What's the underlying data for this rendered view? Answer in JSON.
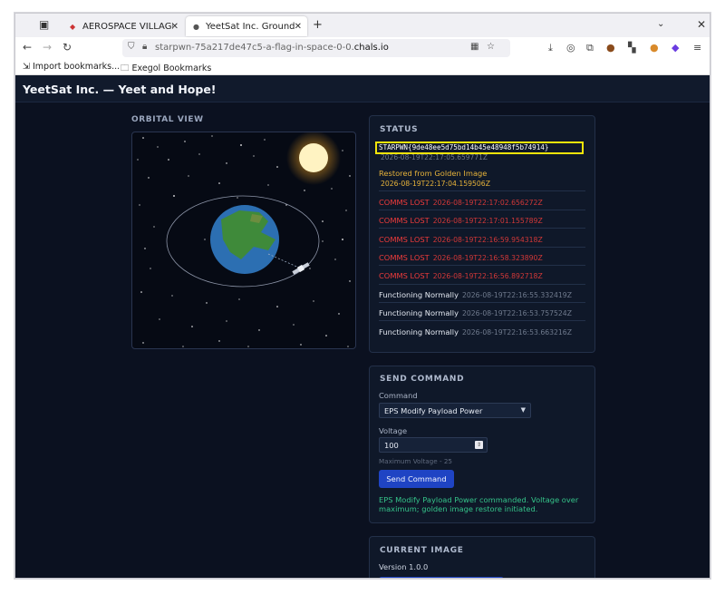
{
  "browser": {
    "tabs": [
      {
        "title": "AEROSPACE VILLAGE S",
        "active": false
      },
      {
        "title": "YeetSat Inc. Ground St",
        "active": true
      }
    ],
    "url_prefix": "starpwn-75a217de47c5-a-flag-in-space-0-0.",
    "url_domain": "chals.io",
    "bookmarks": [
      "Import bookmarks...",
      "Exegol Bookmarks"
    ]
  },
  "app": {
    "title": "YeetSat Inc. — Yeet and Hope!",
    "orbital_title": "ORBITAL VIEW"
  },
  "status": {
    "heading": "STATUS",
    "flag": "STARPWN{9de48ee5d75bd14b45e48948f5b74914}",
    "flag_ts": "2026-08-19T22:17:05.659771Z",
    "restored_label": "Restored from Golden Image",
    "restored_ts": "2026-08-19T22:17:04.159506Z",
    "lost": [
      {
        "label": "COMMS LOST",
        "ts": "2026-08-19T22:17:02.656272Z"
      },
      {
        "label": "COMMS LOST",
        "ts": "2026-08-19T22:17:01.155789Z"
      },
      {
        "label": "COMMS LOST",
        "ts": "2026-08-19T22:16:59.954318Z"
      },
      {
        "label": "COMMS LOST",
        "ts": "2026-08-19T22:16:58.323890Z"
      },
      {
        "label": "COMMS LOST",
        "ts": "2026-08-19T22:16:56.892718Z"
      }
    ],
    "normal": [
      {
        "label": "Functioning Normally",
        "ts": "2026-08-19T22:16:55.332419Z"
      },
      {
        "label": "Functioning Normally",
        "ts": "2026-08-19T22:16:53.757524Z"
      },
      {
        "label": "Functioning Normally",
        "ts": "2026-08-19T22:16:53.663216Z"
      }
    ]
  },
  "command": {
    "heading": "SEND COMMAND",
    "command_label": "Command",
    "command_value": "EPS Modify Payload Power",
    "voltage_label": "Voltage",
    "voltage_value": "100",
    "hint": "Maximum Voltage - 25",
    "send_label": "Send Command",
    "result": "EPS Modify Payload Power commanded. Voltage over maximum; golden image restore initiated."
  },
  "image": {
    "heading": "CURRENT IMAGE",
    "version": "Version 1.0.0"
  },
  "colors": {
    "flag_border": "#f3e40a",
    "lost": "#ef3b3b",
    "restored": "#e6b23a",
    "result": "#35c48a",
    "button": "#1f44c4"
  }
}
